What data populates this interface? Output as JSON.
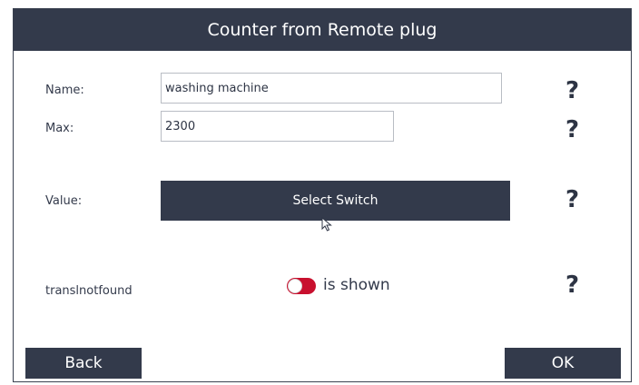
{
  "header": {
    "title": "Counter from Remote plug"
  },
  "fields": {
    "name": {
      "label": "Name:",
      "value": "washing machine"
    },
    "max": {
      "label": "Max:",
      "value": "2300"
    },
    "value": {
      "label": "Value:",
      "button_label": "Select Switch"
    },
    "toggle": {
      "label": "translnotfound",
      "state_text": "is shown",
      "on": true
    }
  },
  "help_symbol": "?",
  "footer": {
    "back_label": "Back",
    "ok_label": "OK"
  },
  "colors": {
    "primary": "#333a4b",
    "toggle_on": "#c8102e",
    "background": "#ffffff"
  }
}
